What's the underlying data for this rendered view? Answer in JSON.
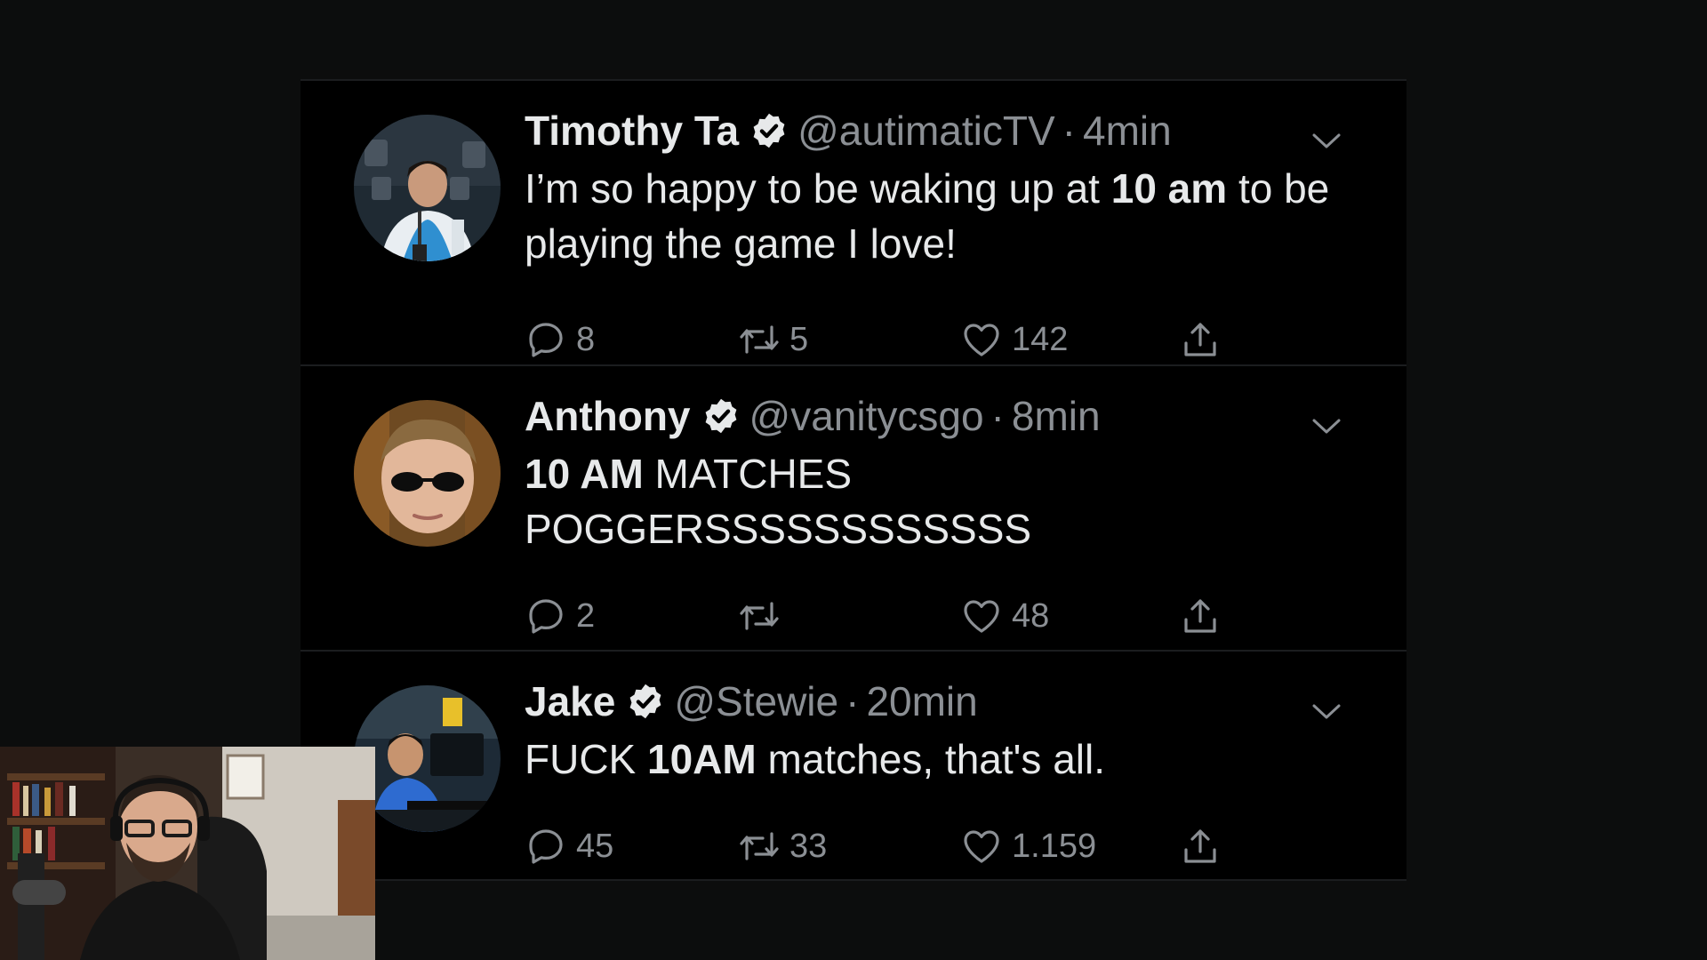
{
  "tweets": [
    {
      "name": "Timothy Ta",
      "handle": "@autimaticTV",
      "separator": "·",
      "time": "4min",
      "body_parts": [
        {
          "text": "I’m so happy to be waking up at ",
          "bold": false
        },
        {
          "text": "10 am",
          "bold": true
        },
        {
          "text": " to be playing the game I love!",
          "bold": false
        }
      ],
      "replies": "8",
      "retweets": "5",
      "likes": "142"
    },
    {
      "name": "Anthony",
      "handle": "@vanitycsgo",
      "separator": "·",
      "time": "8min",
      "body_parts": [
        {
          "text": "10 AM",
          "bold": true
        },
        {
          "text": " MATCHES POGGERSSSSSSSSSSSS",
          "bold": false
        }
      ],
      "replies": "2",
      "retweets": "",
      "likes": "48"
    },
    {
      "name": "Jake",
      "handle": "@Stewie",
      "separator": "·",
      "time": "20min",
      "body_parts": [
        {
          "text": "FUCK ",
          "bold": false
        },
        {
          "text": "10AM",
          "bold": true
        },
        {
          "text": " matches, that's all.",
          "bold": false
        }
      ],
      "replies": "45",
      "retweets": "33",
      "likes": "1.159"
    }
  ],
  "icons": {
    "reply": "reply-icon",
    "retweet": "retweet-icon",
    "like": "heart-icon",
    "share": "share-icon",
    "verified": "verified-badge-icon",
    "caret": "chevron-down-icon"
  },
  "colors": {
    "background": "#0c0d0d",
    "card": "#000000",
    "text": "#e7e9ea",
    "muted": "#8b8f94",
    "divider": "#1b1d1f"
  }
}
